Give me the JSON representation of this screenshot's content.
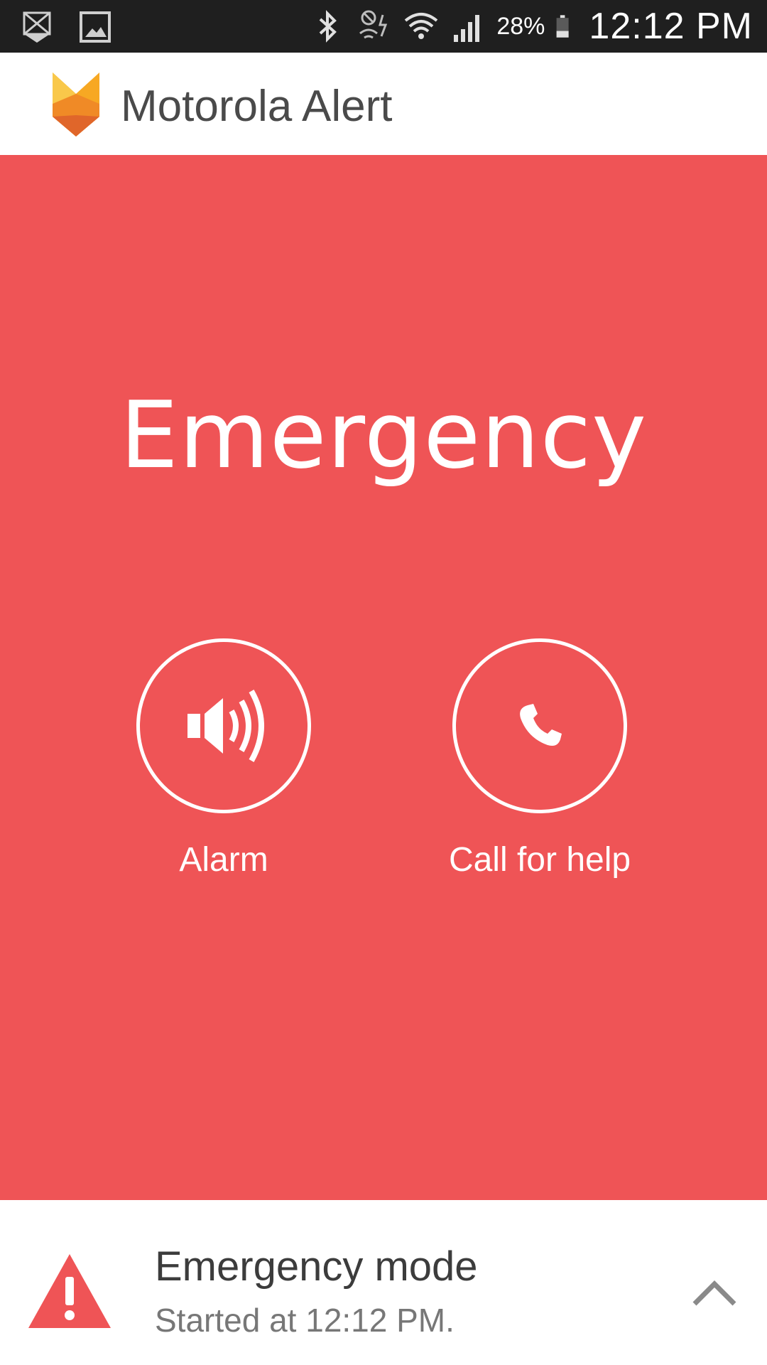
{
  "status_bar": {
    "battery_percent": "28%",
    "time": "12:12 PM",
    "icons": [
      "motorola-alert-icon",
      "gallery-icon",
      "bluetooth-icon",
      "wifi-calling-icon",
      "wifi-icon",
      "signal-icon",
      "battery-icon"
    ]
  },
  "header": {
    "title": "Motorola Alert"
  },
  "emergency": {
    "title": "Emergency",
    "background_color": "#ef5456",
    "actions": [
      {
        "label": "Alarm",
        "icon": "speaker-icon"
      },
      {
        "label": "Call for help",
        "icon": "phone-icon"
      }
    ]
  },
  "notification": {
    "title": "Emergency mode",
    "subtitle": "Started at  12:12 PM.",
    "icon": "warning-icon",
    "accent_color": "#ef5456"
  }
}
